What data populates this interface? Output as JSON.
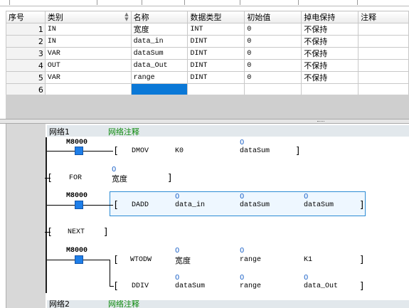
{
  "table": {
    "headers": [
      "序号",
      "类别",
      "名称",
      "数据类型",
      "初始值",
      "掉电保持",
      "注释"
    ],
    "rows": [
      {
        "no": "1",
        "category": "IN",
        "name": "宽度",
        "type": "INT",
        "init": "0",
        "retain": "不保持",
        "comment": ""
      },
      {
        "no": "2",
        "category": "IN",
        "name": "data_in",
        "type": "DINT",
        "init": "0",
        "retain": "不保持",
        "comment": ""
      },
      {
        "no": "3",
        "category": "VAR",
        "name": "dataSum",
        "type": "DINT",
        "init": "0",
        "retain": "不保持",
        "comment": ""
      },
      {
        "no": "4",
        "category": "OUT",
        "name": "data_Out",
        "type": "DINT",
        "init": "0",
        "retain": "不保持",
        "comment": ""
      },
      {
        "no": "5",
        "category": "VAR",
        "name": "range",
        "type": "DINT",
        "init": "0",
        "retain": "不保持",
        "comment": ""
      },
      {
        "no": "6",
        "category": "",
        "name": "",
        "type": "",
        "init": "",
        "retain": "",
        "comment": ""
      }
    ]
  },
  "ladder": {
    "network1": {
      "label": "网络1",
      "comment": "网络注释"
    },
    "network2": {
      "label": "网络2",
      "comment": "网络注释"
    },
    "contact": "M8000",
    "dmov": {
      "op": "DMOV",
      "src": "K0",
      "dst": "dataSum",
      "value": "0"
    },
    "for": {
      "op": "FOR",
      "count": "宽度",
      "value": "0"
    },
    "dadd": {
      "op": "DADD",
      "s1": "data_in",
      "s2": "dataSum",
      "d": "dataSum",
      "v1": "0",
      "v2": "0",
      "v3": "0"
    },
    "next": {
      "op": "NEXT"
    },
    "wtodw": {
      "op": "WTODW",
      "src": "宽度",
      "dst": "range",
      "k": "K1",
      "v1": "0",
      "v2": "0",
      "v3": "0"
    },
    "ddiv": {
      "op": "DDIV",
      "s1": "dataSum",
      "s2": "range",
      "d": "data_Out",
      "v1": "0",
      "v2": "0",
      "v3": "0"
    }
  }
}
